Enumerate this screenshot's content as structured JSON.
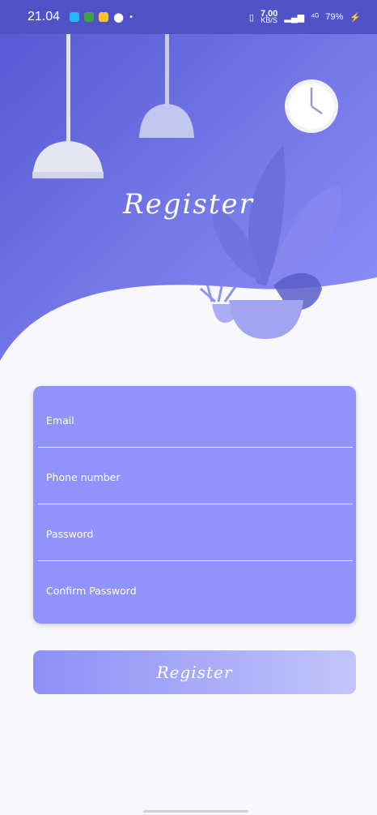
{
  "status_bar": {
    "time": "21.04",
    "speed_value": "7,00",
    "speed_unit": "KB/S",
    "network": "⁴ᴳ",
    "battery": "79%"
  },
  "header": {
    "title": "Register"
  },
  "form": {
    "email_placeholder": "Email",
    "phone_placeholder": "Phone number",
    "password_placeholder": "Password",
    "confirm_password_placeholder": "Confirm Password"
  },
  "submit": {
    "label": "Register"
  },
  "colors": {
    "hero_start": "#5458d2",
    "hero_end": "#8f93fb",
    "card": "#8f93fb",
    "background": "#f8f7fb"
  }
}
